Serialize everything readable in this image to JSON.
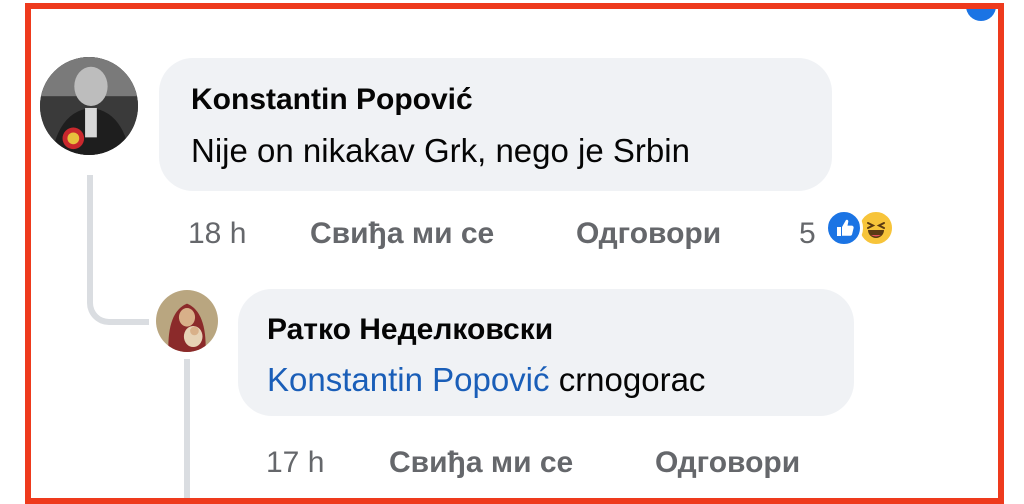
{
  "comment": {
    "author": "Konstantin Popović",
    "text": "Nije on nikakav Grk, nego je Srbin",
    "time": "18 h",
    "like_label": "Свиђа ми се",
    "reply_label": "Одговори",
    "reaction_count": "5",
    "reactions": [
      "like-icon",
      "haha-icon"
    ]
  },
  "reply": {
    "author": "Ратко Неделковски",
    "mention": "Konstantin Popović",
    "text": "crnogorac",
    "time": "17 h",
    "like_label": "Свиђа ми се",
    "reply_label": "Одговори"
  },
  "colors": {
    "frame": "#ee3a1d",
    "bubble": "#f0f2f5",
    "meta_text": "#65676b",
    "mention": "#1a5eb8",
    "like_blue": "#1b74e4",
    "haha_yellow": "#f7c43a"
  }
}
